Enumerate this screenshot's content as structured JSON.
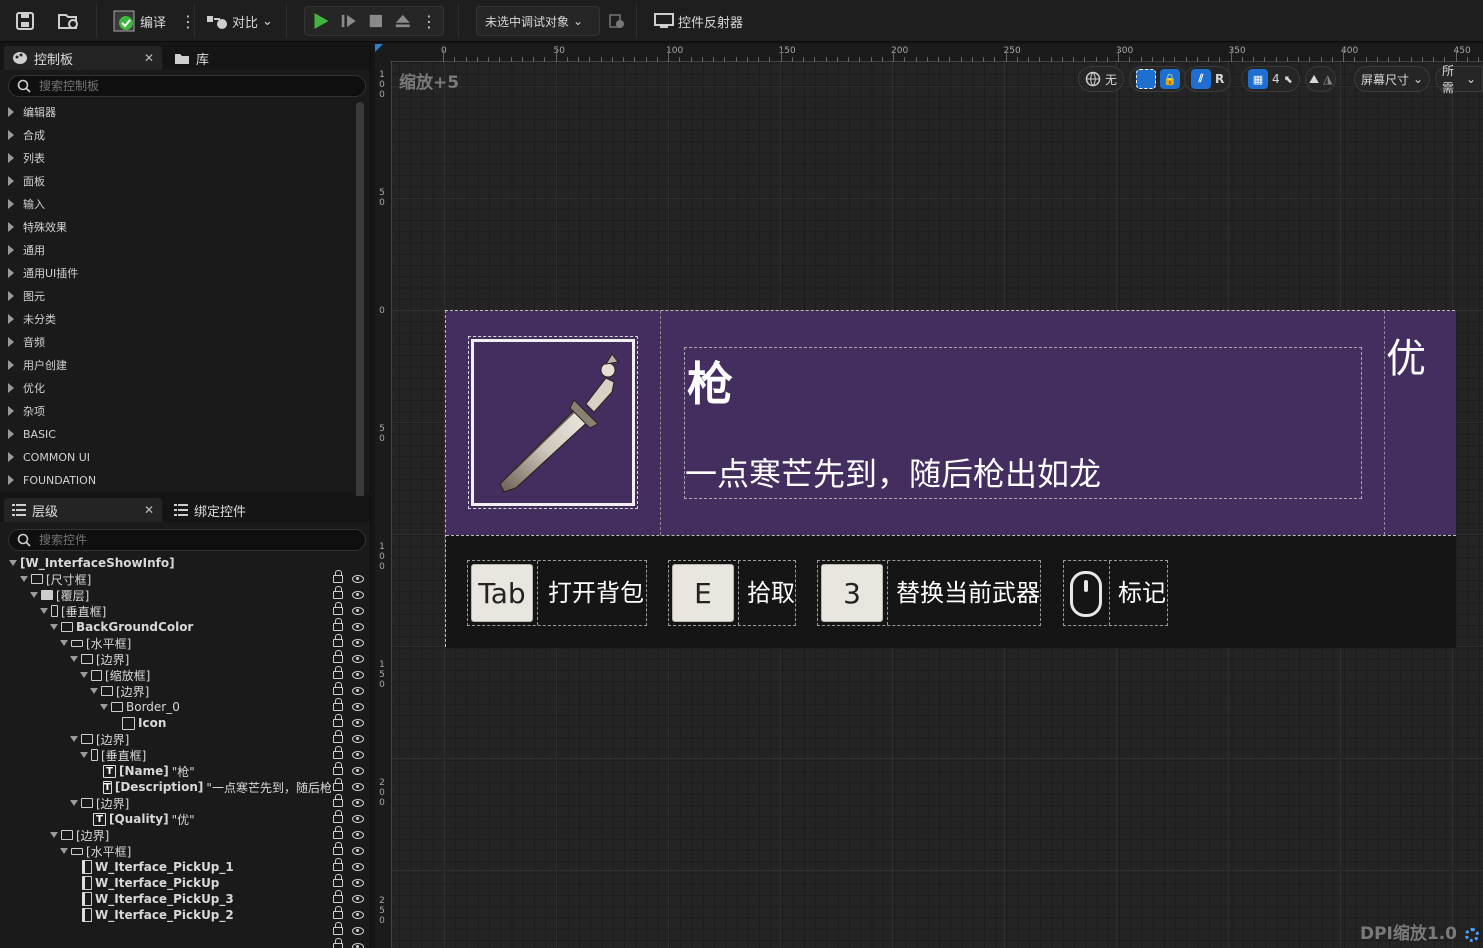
{
  "toolbar": {
    "compile": "编译",
    "diff": "对比",
    "debug_target": "未选中调试对象",
    "widget_reflector": "控件反射器"
  },
  "palette": {
    "tab": "控制板",
    "tab2": "库",
    "search_placeholder": "搜索控制板",
    "categories": [
      "编辑器",
      "合成",
      "列表",
      "面板",
      "输入",
      "特殊效果",
      "通用",
      "通用UI插件",
      "图元",
      "未分类",
      "音频",
      "用户创建",
      "优化",
      "杂项",
      "BASIC",
      "COMMON UI",
      "FOUNDATION"
    ]
  },
  "hierarchy": {
    "tab": "层级",
    "tab2": "绑定控件",
    "search_placeholder": "搜索控件",
    "root": "[W_InterfaceShowInfo]",
    "nodes": [
      "[尺寸框]",
      "[覆层]",
      "[垂直框]",
      "BackGroundColor",
      "[水平框]",
      "[边界]",
      "[缩放框]",
      "[边界]",
      "Border_0",
      "Icon",
      "[边界]",
      "[垂直框]",
      "[Name]",
      "\"枪\"",
      "[Description]",
      "\"一点寒芒先到，随后枪",
      "[边界]",
      "[Quality]",
      "\"优\"",
      "[边界]",
      "[水平框]",
      "W_Iterface_PickUp_1",
      "W_Iterface_PickUp",
      "W_Iterface_PickUp_3",
      "W_Iterface_PickUp_2"
    ]
  },
  "canvas": {
    "zoom_label": "缩放+5",
    "dpi_label": "DPI缩放1.0",
    "ruler_top": [
      "0",
      "50",
      "100",
      "150",
      "200",
      "250",
      "300",
      "350",
      "400",
      "450"
    ],
    "ruler_left": [
      "100",
      "50",
      "0",
      "50",
      "100",
      "150",
      "200",
      "250"
    ],
    "controls": {
      "none": "无",
      "r": "R",
      "grid": "4",
      "screen_size": "屏幕尺寸",
      "fill": "所需"
    }
  },
  "widget": {
    "name": "枪",
    "description": "一点寒芒先到，随后枪出如龙",
    "quality": "优",
    "pickups": [
      {
        "key": "Tab",
        "label": "打开背包"
      },
      {
        "key": "E",
        "label": "拾取"
      },
      {
        "key": "3",
        "label": "替换当前武器"
      },
      {
        "key": "mouse-icon",
        "label": "标记"
      }
    ]
  },
  "colors": {
    "accent": "#1f6fd1",
    "widget_bg": "#432e5f",
    "play_green": "#3fb63f"
  }
}
